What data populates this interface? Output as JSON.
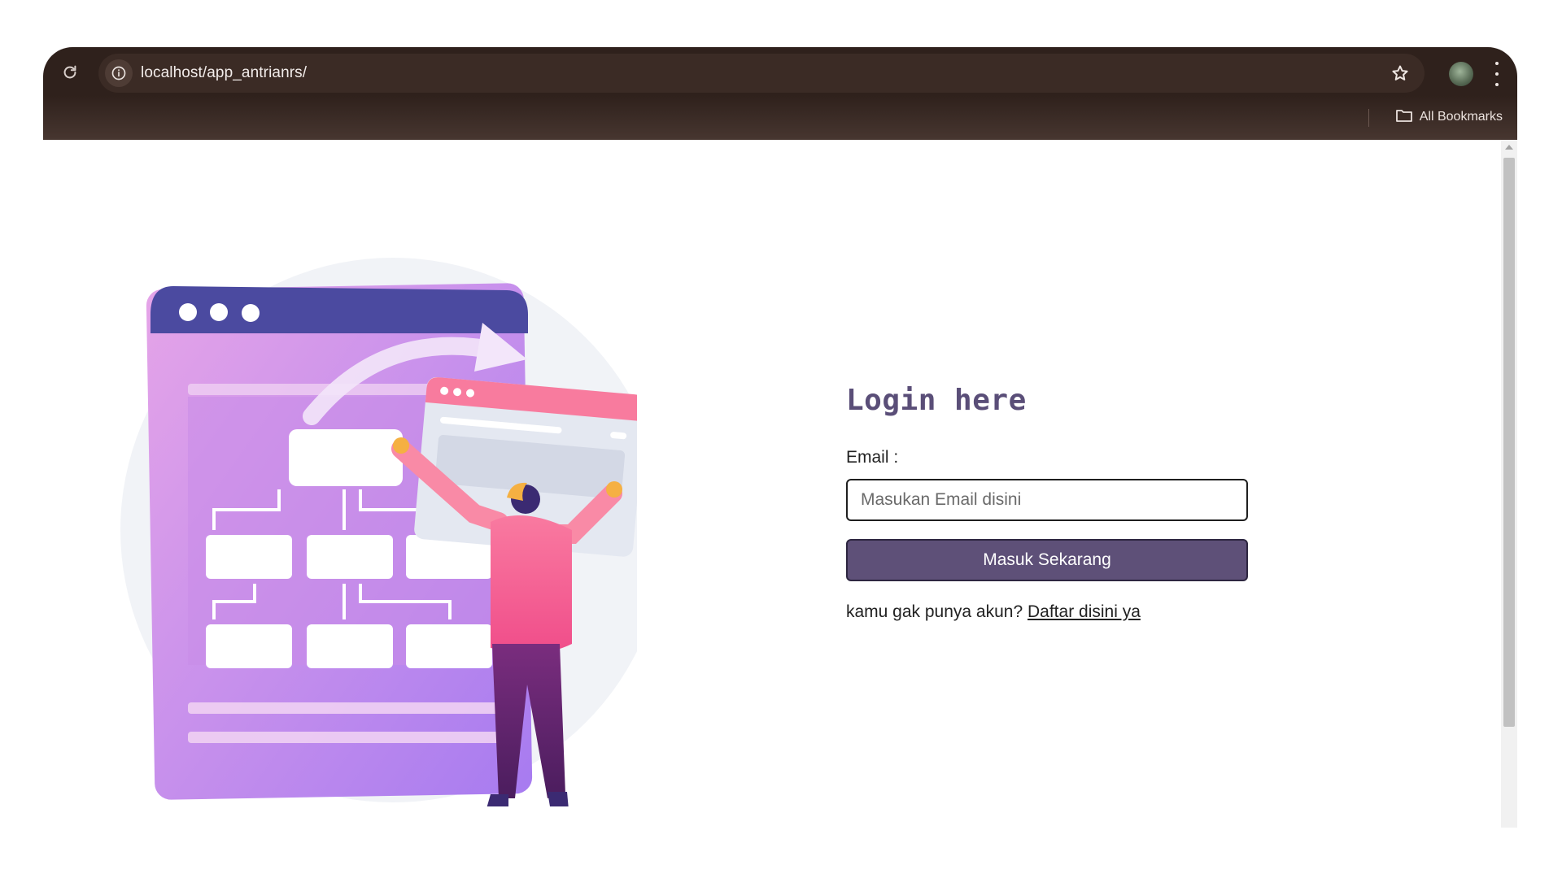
{
  "browser": {
    "url": "localhost/app_antrianrs/",
    "bookmarks_label": "All Bookmarks",
    "icons": [
      "reload-icon",
      "site-info-icon",
      "bookmark-star-icon",
      "profile-avatar",
      "menu-icon",
      "folder-icon"
    ],
    "colors": {
      "toolbar": "#2f211c",
      "bookmark_bar": "#473630",
      "omnibox": "#3b2b25"
    }
  },
  "login": {
    "title": "Login here",
    "email_label": "Email :",
    "email_placeholder": "Masukan Email disini",
    "email_value": "",
    "submit_label": "Masuk Sekarang",
    "register_prompt": "kamu gak punya akun?",
    "register_link": "Daftar disini ya"
  },
  "colors": {
    "accent": "#5e5078",
    "title": "#5a4e78"
  }
}
